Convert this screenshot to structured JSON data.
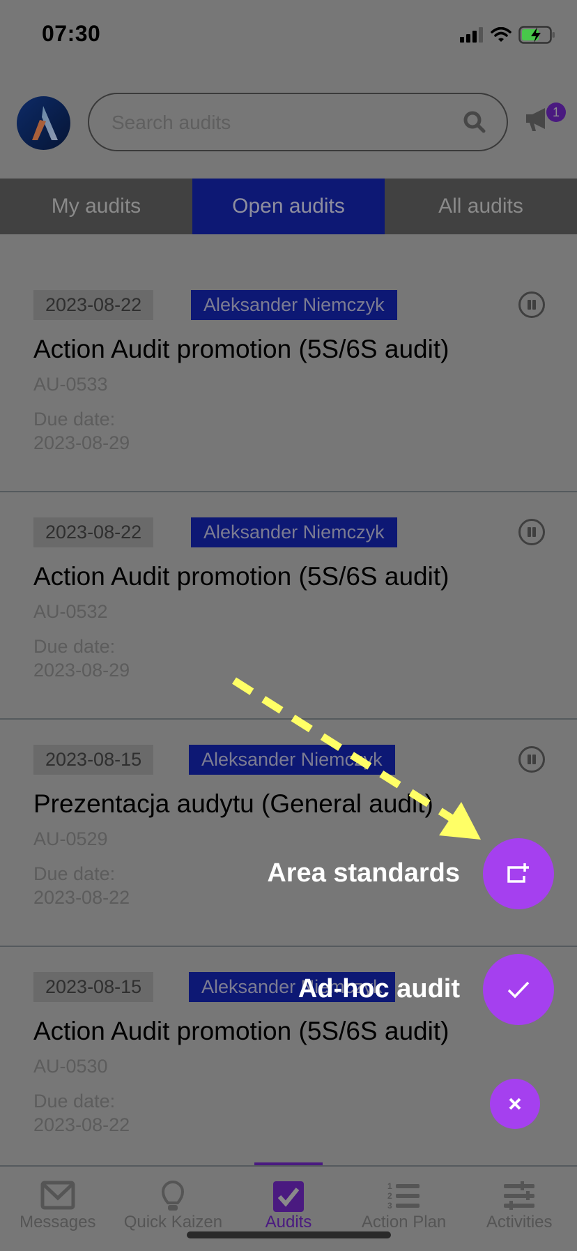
{
  "status_bar": {
    "time": "07:30"
  },
  "header": {
    "search_placeholder": "Search audits",
    "notification_count": "1"
  },
  "tabs": [
    {
      "label": "My audits",
      "active": false
    },
    {
      "label": "Open audits",
      "active": true
    },
    {
      "label": "All audits",
      "active": false
    }
  ],
  "audits": [
    {
      "date": "2023-08-22",
      "owner": "Aleksander Niemczyk",
      "title": "Action Audit promotion (5S/6S audit)",
      "code": "AU-0533",
      "due_label": "Due date:",
      "due_date": "2023-08-29",
      "status_icon": "pause-icon"
    },
    {
      "date": "2023-08-22",
      "owner": "Aleksander Niemczyk",
      "title": "Action Audit promotion (5S/6S audit)",
      "code": "AU-0532",
      "due_label": "Due date:",
      "due_date": "2023-08-29",
      "status_icon": "pause-icon"
    },
    {
      "date": "2023-08-15",
      "owner": "Aleksander Niemczyk",
      "title": "Prezentacja audytu (General audit)",
      "code": "AU-0529",
      "due_label": "Due date:",
      "due_date": "2023-08-22",
      "status_icon": "pause-icon"
    },
    {
      "date": "2023-08-15",
      "owner": "Aleksander Niemczyk",
      "title": "Action Audit promotion (5S/6S audit)",
      "code": "AU-0530",
      "due_label": "Due date:",
      "due_date": "2023-08-22",
      "status_icon": "pause-icon"
    }
  ],
  "fab_menu": {
    "items": [
      {
        "label": "Area standards",
        "icon": "add-area-icon"
      },
      {
        "label": "Ad-hoc audit",
        "icon": "check-icon"
      }
    ],
    "close_icon": "close-icon"
  },
  "bottom_nav": [
    {
      "label": "Messages",
      "icon": "mail-icon",
      "active": false
    },
    {
      "label": "Quick Kaizen",
      "icon": "lightbulb-icon",
      "active": false
    },
    {
      "label": "Audits",
      "icon": "checkbox-icon",
      "active": true
    },
    {
      "label": "Action Plan",
      "icon": "numbered-list-icon",
      "active": false
    },
    {
      "label": "Activities",
      "icon": "sliders-icon",
      "active": false
    }
  ],
  "colors": {
    "overlay_bg": "#777777",
    "fab": "#a540ef",
    "tab_active": "#0d1874",
    "accent": "#4a1a80",
    "annotation_arrow": "#ffff66"
  }
}
